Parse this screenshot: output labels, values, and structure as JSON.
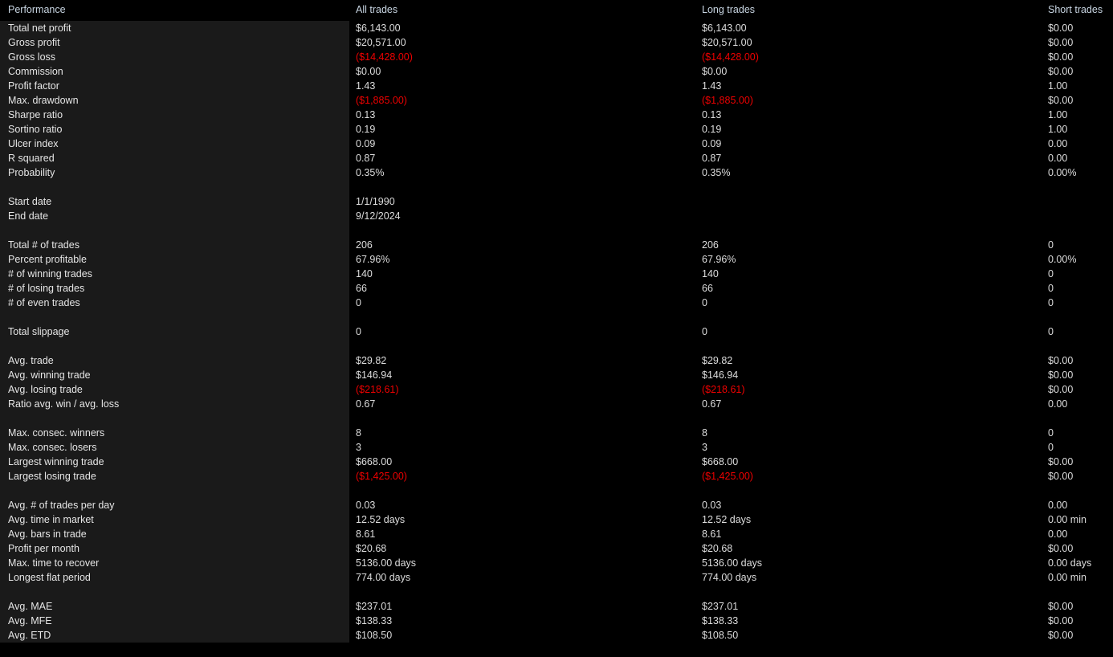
{
  "header": {
    "performance": "Performance",
    "all_trades": "All trades",
    "long_trades": "Long trades",
    "short_trades": "Short trades"
  },
  "colors": {
    "background": "#000000",
    "label_panel": "#1a1a1a",
    "header_text": "#c9d6e3",
    "value_text": "#dcdcdc",
    "negative_text": "#ee0000"
  },
  "rows": [
    {
      "label": "Total net profit",
      "all": "$6,143.00",
      "long": "$6,143.00",
      "short": "$0.00"
    },
    {
      "label": "Gross profit",
      "all": "$20,571.00",
      "long": "$20,571.00",
      "short": "$0.00"
    },
    {
      "label": "Gross loss",
      "all": "($14,428.00)",
      "long": "($14,428.00)",
      "short": "$0.00",
      "all_neg": true,
      "long_neg": true
    },
    {
      "label": "Commission",
      "all": "$0.00",
      "long": "$0.00",
      "short": "$0.00"
    },
    {
      "label": "Profit factor",
      "all": "1.43",
      "long": "1.43",
      "short": "1.00"
    },
    {
      "label": "Max. drawdown",
      "all": "($1,885.00)",
      "long": "($1,885.00)",
      "short": "$0.00",
      "all_neg": true,
      "long_neg": true
    },
    {
      "label": "Sharpe ratio",
      "all": "0.13",
      "long": "0.13",
      "short": "1.00"
    },
    {
      "label": "Sortino ratio",
      "all": "0.19",
      "long": "0.19",
      "short": "1.00"
    },
    {
      "label": "Ulcer index",
      "all": "0.09",
      "long": "0.09",
      "short": "0.00"
    },
    {
      "label": "R squared",
      "all": "0.87",
      "long": "0.87",
      "short": "0.00"
    },
    {
      "label": "Probability",
      "all": "0.35%",
      "long": "0.35%",
      "short": "0.00%"
    },
    {
      "spacer": true
    },
    {
      "label": "Start date",
      "all": "1/1/1990",
      "long": "",
      "short": ""
    },
    {
      "label": "End date",
      "all": "9/12/2024",
      "long": "",
      "short": ""
    },
    {
      "spacer": true
    },
    {
      "label": "Total # of trades",
      "all": "206",
      "long": "206",
      "short": "0"
    },
    {
      "label": "Percent profitable",
      "all": "67.96%",
      "long": "67.96%",
      "short": "0.00%"
    },
    {
      "label": "# of winning trades",
      "all": "140",
      "long": "140",
      "short": "0"
    },
    {
      "label": "# of losing trades",
      "all": "66",
      "long": "66",
      "short": "0"
    },
    {
      "label": "# of even trades",
      "all": "0",
      "long": "0",
      "short": "0"
    },
    {
      "spacer": true
    },
    {
      "label": "Total slippage",
      "all": "0",
      "long": "0",
      "short": "0"
    },
    {
      "spacer": true
    },
    {
      "label": "Avg. trade",
      "all": "$29.82",
      "long": "$29.82",
      "short": "$0.00"
    },
    {
      "label": "Avg. winning trade",
      "all": "$146.94",
      "long": "$146.94",
      "short": "$0.00"
    },
    {
      "label": "Avg. losing trade",
      "all": "($218.61)",
      "long": "($218.61)",
      "short": "$0.00",
      "all_neg": true,
      "long_neg": true
    },
    {
      "label": "Ratio avg. win / avg. loss",
      "all": "0.67",
      "long": "0.67",
      "short": "0.00"
    },
    {
      "spacer": true
    },
    {
      "label": "Max. consec. winners",
      "all": "8",
      "long": "8",
      "short": "0"
    },
    {
      "label": "Max. consec. losers",
      "all": "3",
      "long": "3",
      "short": "0"
    },
    {
      "label": "Largest winning trade",
      "all": "$668.00",
      "long": "$668.00",
      "short": "$0.00"
    },
    {
      "label": "Largest losing trade",
      "all": "($1,425.00)",
      "long": "($1,425.00)",
      "short": "$0.00",
      "all_neg": true,
      "long_neg": true
    },
    {
      "spacer": true
    },
    {
      "label": "Avg. # of trades per day",
      "all": "0.03",
      "long": "0.03",
      "short": "0.00"
    },
    {
      "label": "Avg. time in market",
      "all": "12.52 days",
      "long": "12.52 days",
      "short": "0.00 min"
    },
    {
      "label": "Avg. bars in trade",
      "all": "8.61",
      "long": "8.61",
      "short": "0.00"
    },
    {
      "label": "Profit per month",
      "all": "$20.68",
      "long": "$20.68",
      "short": "$0.00"
    },
    {
      "label": "Max. time to recover",
      "all": "5136.00 days",
      "long": "5136.00 days",
      "short": "0.00 days"
    },
    {
      "label": "Longest flat period",
      "all": "774.00 days",
      "long": "774.00 days",
      "short": "0.00 min"
    },
    {
      "spacer": true
    },
    {
      "label": "Avg. MAE",
      "all": "$237.01",
      "long": "$237.01",
      "short": "$0.00"
    },
    {
      "label": "Avg. MFE",
      "all": "$138.33",
      "long": "$138.33",
      "short": "$0.00"
    },
    {
      "label": "Avg. ETD",
      "all": "$108.50",
      "long": "$108.50",
      "short": "$0.00"
    }
  ]
}
